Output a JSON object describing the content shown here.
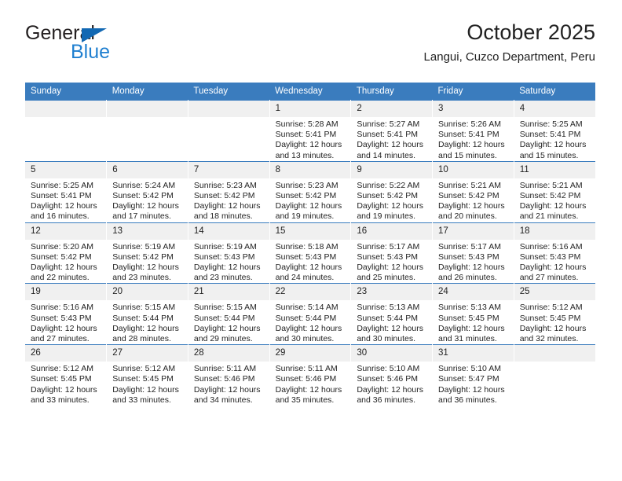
{
  "brand": {
    "name_top": "General",
    "name_bottom": "Blue",
    "triangle_color": "#1268b3",
    "blue_color": "#1f7fd0"
  },
  "header": {
    "title": "October 2025",
    "subtitle": "Langui, Cuzco Department, Peru"
  },
  "theme": {
    "header_bg": "#3a7cbe",
    "daynum_bg": "#f0f0f0",
    "text": "#232323"
  },
  "calendar": {
    "weekdays": [
      "Sunday",
      "Monday",
      "Tuesday",
      "Wednesday",
      "Thursday",
      "Friday",
      "Saturday"
    ],
    "labels": {
      "sunrise": "Sunrise:",
      "sunset": "Sunset:",
      "daylight": "Daylight:"
    },
    "weeks": [
      [
        {
          "day": "",
          "empty": true
        },
        {
          "day": "",
          "empty": true
        },
        {
          "day": "",
          "empty": true
        },
        {
          "day": "1",
          "sunrise": "Sunrise: 5:28 AM",
          "sunset": "Sunset: 5:41 PM",
          "daylight": "Daylight: 12 hours and 13 minutes."
        },
        {
          "day": "2",
          "sunrise": "Sunrise: 5:27 AM",
          "sunset": "Sunset: 5:41 PM",
          "daylight": "Daylight: 12 hours and 14 minutes."
        },
        {
          "day": "3",
          "sunrise": "Sunrise: 5:26 AM",
          "sunset": "Sunset: 5:41 PM",
          "daylight": "Daylight: 12 hours and 15 minutes."
        },
        {
          "day": "4",
          "sunrise": "Sunrise: 5:25 AM",
          "sunset": "Sunset: 5:41 PM",
          "daylight": "Daylight: 12 hours and 15 minutes."
        }
      ],
      [
        {
          "day": "5",
          "sunrise": "Sunrise: 5:25 AM",
          "sunset": "Sunset: 5:41 PM",
          "daylight": "Daylight: 12 hours and 16 minutes."
        },
        {
          "day": "6",
          "sunrise": "Sunrise: 5:24 AM",
          "sunset": "Sunset: 5:42 PM",
          "daylight": "Daylight: 12 hours and 17 minutes."
        },
        {
          "day": "7",
          "sunrise": "Sunrise: 5:23 AM",
          "sunset": "Sunset: 5:42 PM",
          "daylight": "Daylight: 12 hours and 18 minutes."
        },
        {
          "day": "8",
          "sunrise": "Sunrise: 5:23 AM",
          "sunset": "Sunset: 5:42 PM",
          "daylight": "Daylight: 12 hours and 19 minutes."
        },
        {
          "day": "9",
          "sunrise": "Sunrise: 5:22 AM",
          "sunset": "Sunset: 5:42 PM",
          "daylight": "Daylight: 12 hours and 19 minutes."
        },
        {
          "day": "10",
          "sunrise": "Sunrise: 5:21 AM",
          "sunset": "Sunset: 5:42 PM",
          "daylight": "Daylight: 12 hours and 20 minutes."
        },
        {
          "day": "11",
          "sunrise": "Sunrise: 5:21 AM",
          "sunset": "Sunset: 5:42 PM",
          "daylight": "Daylight: 12 hours and 21 minutes."
        }
      ],
      [
        {
          "day": "12",
          "sunrise": "Sunrise: 5:20 AM",
          "sunset": "Sunset: 5:42 PM",
          "daylight": "Daylight: 12 hours and 22 minutes."
        },
        {
          "day": "13",
          "sunrise": "Sunrise: 5:19 AM",
          "sunset": "Sunset: 5:42 PM",
          "daylight": "Daylight: 12 hours and 23 minutes."
        },
        {
          "day": "14",
          "sunrise": "Sunrise: 5:19 AM",
          "sunset": "Sunset: 5:43 PM",
          "daylight": "Daylight: 12 hours and 23 minutes."
        },
        {
          "day": "15",
          "sunrise": "Sunrise: 5:18 AM",
          "sunset": "Sunset: 5:43 PM",
          "daylight": "Daylight: 12 hours and 24 minutes."
        },
        {
          "day": "16",
          "sunrise": "Sunrise: 5:17 AM",
          "sunset": "Sunset: 5:43 PM",
          "daylight": "Daylight: 12 hours and 25 minutes."
        },
        {
          "day": "17",
          "sunrise": "Sunrise: 5:17 AM",
          "sunset": "Sunset: 5:43 PM",
          "daylight": "Daylight: 12 hours and 26 minutes."
        },
        {
          "day": "18",
          "sunrise": "Sunrise: 5:16 AM",
          "sunset": "Sunset: 5:43 PM",
          "daylight": "Daylight: 12 hours and 27 minutes."
        }
      ],
      [
        {
          "day": "19",
          "sunrise": "Sunrise: 5:16 AM",
          "sunset": "Sunset: 5:43 PM",
          "daylight": "Daylight: 12 hours and 27 minutes."
        },
        {
          "day": "20",
          "sunrise": "Sunrise: 5:15 AM",
          "sunset": "Sunset: 5:44 PM",
          "daylight": "Daylight: 12 hours and 28 minutes."
        },
        {
          "day": "21",
          "sunrise": "Sunrise: 5:15 AM",
          "sunset": "Sunset: 5:44 PM",
          "daylight": "Daylight: 12 hours and 29 minutes."
        },
        {
          "day": "22",
          "sunrise": "Sunrise: 5:14 AM",
          "sunset": "Sunset: 5:44 PM",
          "daylight": "Daylight: 12 hours and 30 minutes."
        },
        {
          "day": "23",
          "sunrise": "Sunrise: 5:13 AM",
          "sunset": "Sunset: 5:44 PM",
          "daylight": "Daylight: 12 hours and 30 minutes."
        },
        {
          "day": "24",
          "sunrise": "Sunrise: 5:13 AM",
          "sunset": "Sunset: 5:45 PM",
          "daylight": "Daylight: 12 hours and 31 minutes."
        },
        {
          "day": "25",
          "sunrise": "Sunrise: 5:12 AM",
          "sunset": "Sunset: 5:45 PM",
          "daylight": "Daylight: 12 hours and 32 minutes."
        }
      ],
      [
        {
          "day": "26",
          "sunrise": "Sunrise: 5:12 AM",
          "sunset": "Sunset: 5:45 PM",
          "daylight": "Daylight: 12 hours and 33 minutes."
        },
        {
          "day": "27",
          "sunrise": "Sunrise: 5:12 AM",
          "sunset": "Sunset: 5:45 PM",
          "daylight": "Daylight: 12 hours and 33 minutes."
        },
        {
          "day": "28",
          "sunrise": "Sunrise: 5:11 AM",
          "sunset": "Sunset: 5:46 PM",
          "daylight": "Daylight: 12 hours and 34 minutes."
        },
        {
          "day": "29",
          "sunrise": "Sunrise: 5:11 AM",
          "sunset": "Sunset: 5:46 PM",
          "daylight": "Daylight: 12 hours and 35 minutes."
        },
        {
          "day": "30",
          "sunrise": "Sunrise: 5:10 AM",
          "sunset": "Sunset: 5:46 PM",
          "daylight": "Daylight: 12 hours and 36 minutes."
        },
        {
          "day": "31",
          "sunrise": "Sunrise: 5:10 AM",
          "sunset": "Sunset: 5:47 PM",
          "daylight": "Daylight: 12 hours and 36 minutes."
        },
        {
          "day": "",
          "empty": true
        }
      ]
    ]
  }
}
